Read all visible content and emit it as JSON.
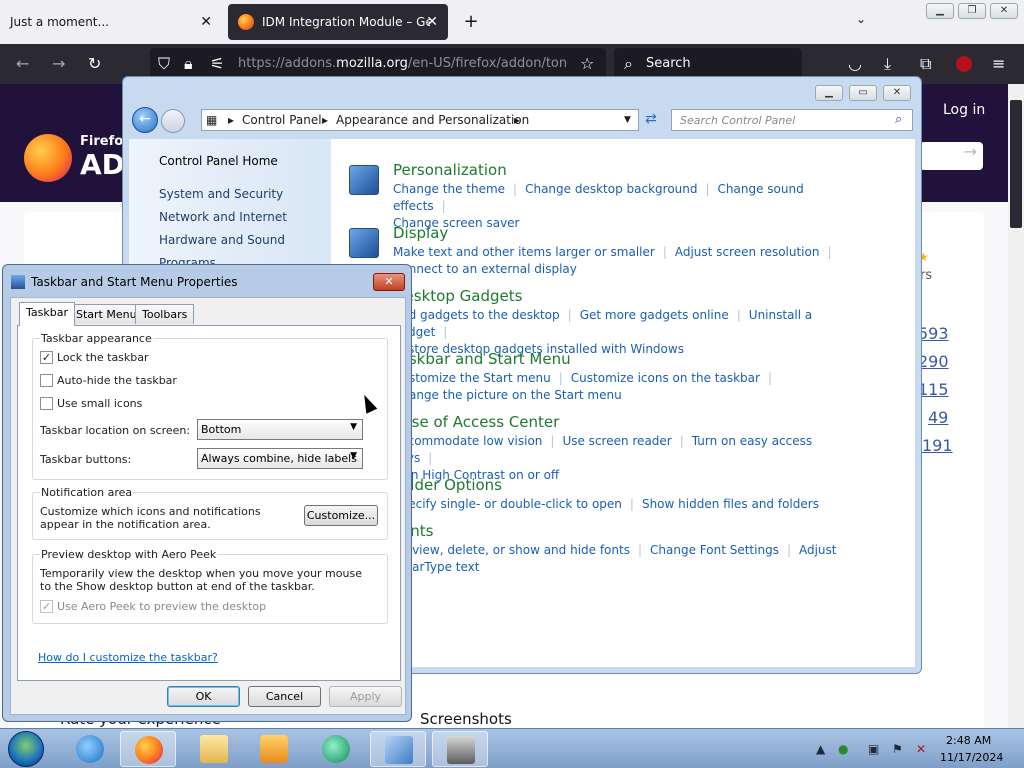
{
  "browser": {
    "tab1_title": "Just a moment...",
    "tab2_title": "IDM Integration Module – Get",
    "url_prefix": "https://addons.",
    "url_domain": "mozilla.org",
    "url_rest": "/en-US/firefox/addon/tonec",
    "search_label": "Search",
    "new_tab": "+",
    "close": "✕"
  },
  "page": {
    "brand_small": "Firefox",
    "brand_big": "AD",
    "login": "Log in",
    "stats": [
      "593",
      "290",
      "115",
      "49",
      "191"
    ],
    "rating_stars": "★",
    "rating_label": "rs",
    "screenshots_heading": "Screenshots",
    "rate_heading": "Rate your experience"
  },
  "control_panel": {
    "breadcrumb": [
      "Control Panel",
      "Appearance and Personalization"
    ],
    "search_placeholder": "Search Control Panel",
    "left_nav": [
      "Control Panel Home",
      "System and Security",
      "Network and Internet",
      "Hardware and Sound",
      "Programs"
    ],
    "categories": [
      {
        "title": "Personalization",
        "links": [
          "Change the theme",
          "Change desktop background",
          "Change sound effects",
          "Change screen saver"
        ]
      },
      {
        "title": "Display",
        "links": [
          "Make text and other items larger or smaller",
          "Adjust screen resolution",
          "Connect to an external display"
        ]
      },
      {
        "title": "Desktop Gadgets",
        "links": [
          "Add gadgets to the desktop",
          "Get more gadgets online",
          "Uninstall a gadget",
          "Restore desktop gadgets installed with Windows"
        ]
      },
      {
        "title": "Taskbar and Start Menu",
        "links": [
          "Customize the Start menu",
          "Customize icons on the taskbar",
          "Change the picture on the Start menu"
        ]
      },
      {
        "title": "Ease of Access Center",
        "links": [
          "Accommodate low vision",
          "Use screen reader",
          "Turn on easy access keys",
          "Turn High Contrast on or off"
        ]
      },
      {
        "title": "Folder Options",
        "links": [
          "Specify single- or double-click to open",
          "Show hidden files and folders"
        ]
      },
      {
        "title": "Fonts",
        "links": [
          "Preview, delete, or show and hide fonts",
          "Change Font Settings",
          "Adjust ClearType text"
        ]
      }
    ]
  },
  "dialog": {
    "title": "Taskbar and Start Menu Properties",
    "tabs": [
      "Taskbar",
      "Start Menu",
      "Toolbars"
    ],
    "appearance_group": "Taskbar appearance",
    "lock_taskbar": "Lock the taskbar",
    "auto_hide": "Auto-hide the taskbar",
    "small_icons": "Use small icons",
    "location_label": "Taskbar location on screen:",
    "location_value": "Bottom",
    "buttons_label": "Taskbar buttons:",
    "buttons_value": "Always combine, hide labels",
    "notification_group": "Notification area",
    "notification_text": "Customize which icons and notifications appear in the notification area.",
    "customize_button": "Customize...",
    "peek_group": "Preview desktop with Aero Peek",
    "peek_text": "Temporarily view the desktop when you move your mouse to the Show desktop button at end of the taskbar.",
    "peek_checkbox": "Use Aero Peek to preview the desktop",
    "help_link": "How do I customize the taskbar?",
    "ok": "OK",
    "cancel": "Cancel",
    "apply": "Apply",
    "check_mark": "✓"
  },
  "taskbar": {
    "time": "2:48 AM",
    "date": "11/17/2024"
  }
}
